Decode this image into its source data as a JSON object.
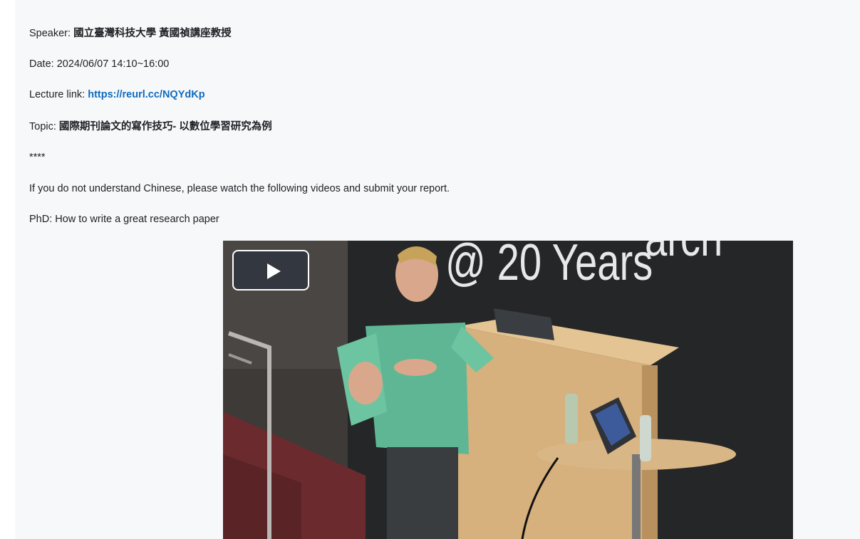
{
  "content": {
    "speaker_label": "Speaker: ",
    "speaker_value": "國立臺灣科技大學 黃國禎講座教授",
    "date_label": "Date: ",
    "date_value": "2024/06/07 14:10~16:00",
    "lecture_label": "Lecture link: ",
    "lecture_link": "https://reurl.cc/NQYdKp",
    "topic_label": "Topic: ",
    "topic_value": "國際期刊論文的寫作技巧- 以數位學習研究為例",
    "separator": "****",
    "instruction": "If you do not understand Chinese, please watch the following videos and submit your report.",
    "video_title": "PhD: How to write a great research paper"
  },
  "video": {
    "backdrop_text": "@ 20 Years",
    "backdrop_text_partial": "arch",
    "play_icon": "play-icon"
  },
  "colors": {
    "panel_bg": "#f7f8fa",
    "text": "#1d2125",
    "link": "#0f6cbf"
  }
}
